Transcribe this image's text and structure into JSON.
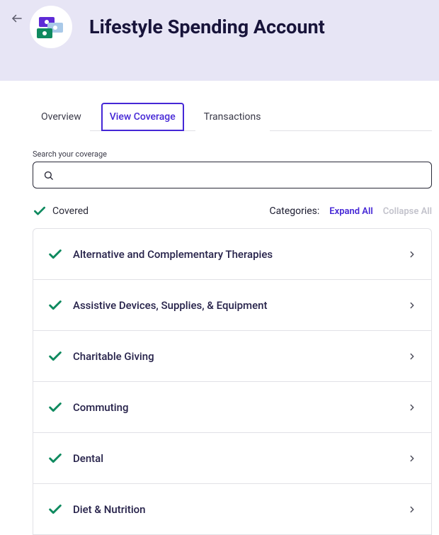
{
  "header": {
    "title": "Lifestyle Spending Account"
  },
  "tabs": [
    {
      "label": "Overview",
      "active": false
    },
    {
      "label": "View Coverage",
      "active": true
    },
    {
      "label": "Transactions",
      "active": false
    }
  ],
  "search": {
    "label": "Search your coverage",
    "value": ""
  },
  "legend": {
    "covered": "Covered",
    "categories_label": "Categories:",
    "expand_all": "Expand All",
    "collapse_all": "Collapse All"
  },
  "categories": [
    {
      "title": "Alternative and Complementary Therapies"
    },
    {
      "title": "Assistive Devices, Supplies, & Equipment"
    },
    {
      "title": "Charitable Giving"
    },
    {
      "title": "Commuting"
    },
    {
      "title": "Dental"
    },
    {
      "title": "Diet & Nutrition"
    }
  ]
}
